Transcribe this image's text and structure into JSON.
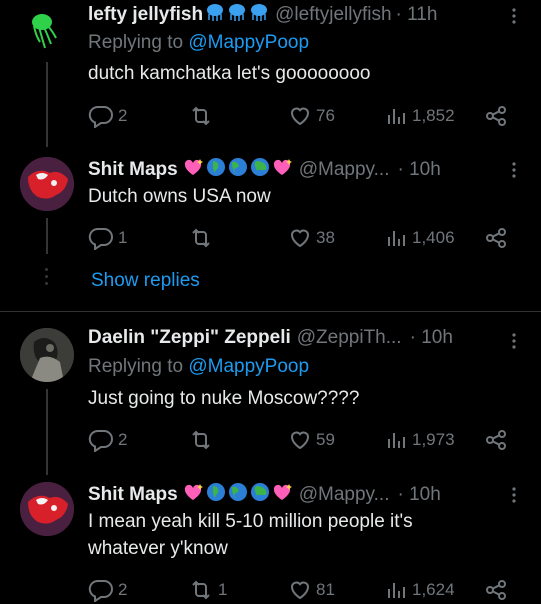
{
  "posts": [
    {
      "name": "lefty jellyfish",
      "handle": "@leftyjellyfish",
      "time": "· 11h",
      "replying_prefix": "Replying to ",
      "replying_handle": "@MappyPoop",
      "text": "dutch kamchatka let's goooooooo",
      "replies": "2",
      "retweets": "",
      "likes": "76",
      "views": "1,852",
      "name_emojis": [
        "jellyfish",
        "jellyfish",
        "jellyfish"
      ]
    },
    {
      "name": "Shit Maps",
      "handle": "@Mappy...",
      "time": "· 10h",
      "text": "Dutch owns USA now",
      "replies": "1",
      "retweets": "",
      "likes": "38",
      "views": "1,406",
      "name_emojis": [
        "heart-sparkle",
        "globe-africa",
        "globe-americas",
        "globe-asia",
        "heart-sparkle"
      ]
    },
    {
      "name": "Daelin \"Zeppi\" Zeppeli",
      "handle": "@ZeppiTh...",
      "time": "· 10h",
      "replying_prefix": "Replying to ",
      "replying_handle": "@MappyPoop",
      "text": "Just going to nuke Moscow????",
      "replies": "2",
      "retweets": "",
      "likes": "59",
      "views": "1,973"
    },
    {
      "name": "Shit Maps",
      "handle": "@Mappy...",
      "time": "· 10h",
      "text_line1": "I mean yeah kill 5-10 million people it's",
      "text_line2": "whatever y'know",
      "replies": "2",
      "retweets": "1",
      "likes": "81",
      "views": "1,624",
      "name_emojis": [
        "heart-sparkle",
        "globe-africa",
        "globe-americas",
        "globe-asia",
        "heart-sparkle"
      ]
    }
  ],
  "show_replies": "Show replies",
  "colors": {
    "background": "#000000",
    "text": "#e7e9ea",
    "secondary": "#71767b",
    "link": "#1d9bf0",
    "divider": "#2f3336"
  }
}
